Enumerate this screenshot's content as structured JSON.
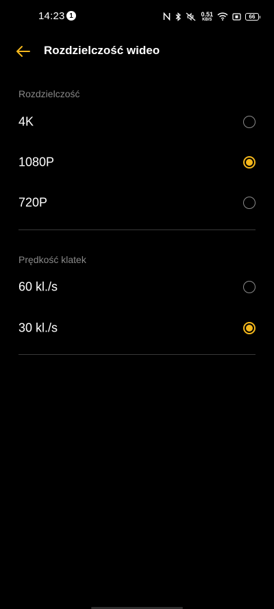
{
  "status_bar": {
    "time": "14:23",
    "notification_count": "1",
    "net_speed_value": "0.51",
    "net_speed_unit": "KB/S",
    "battery": "66",
    "icons": [
      "nfc-icon",
      "bluetooth-icon",
      "vibrate-mute-icon",
      "wifi-icon",
      "screen-record-icon",
      "battery-icon"
    ]
  },
  "header": {
    "title": "Rozdzielczość wideo",
    "back_icon": "arrow-left-icon"
  },
  "resolution": {
    "label": "Rozdzielczość",
    "options": [
      {
        "label": "4K",
        "selected": false
      },
      {
        "label": "1080P",
        "selected": true
      },
      {
        "label": "720P",
        "selected": false
      }
    ]
  },
  "frame_rate": {
    "label": "Prędkość klatek",
    "options": [
      {
        "label": "60 kl./s",
        "selected": false
      },
      {
        "label": "30 kl./s",
        "selected": true
      }
    ]
  },
  "colors": {
    "accent": "#f5b81c",
    "background": "#000000",
    "section_label": "#8a8a8a",
    "divider": "#3a3a3a"
  }
}
